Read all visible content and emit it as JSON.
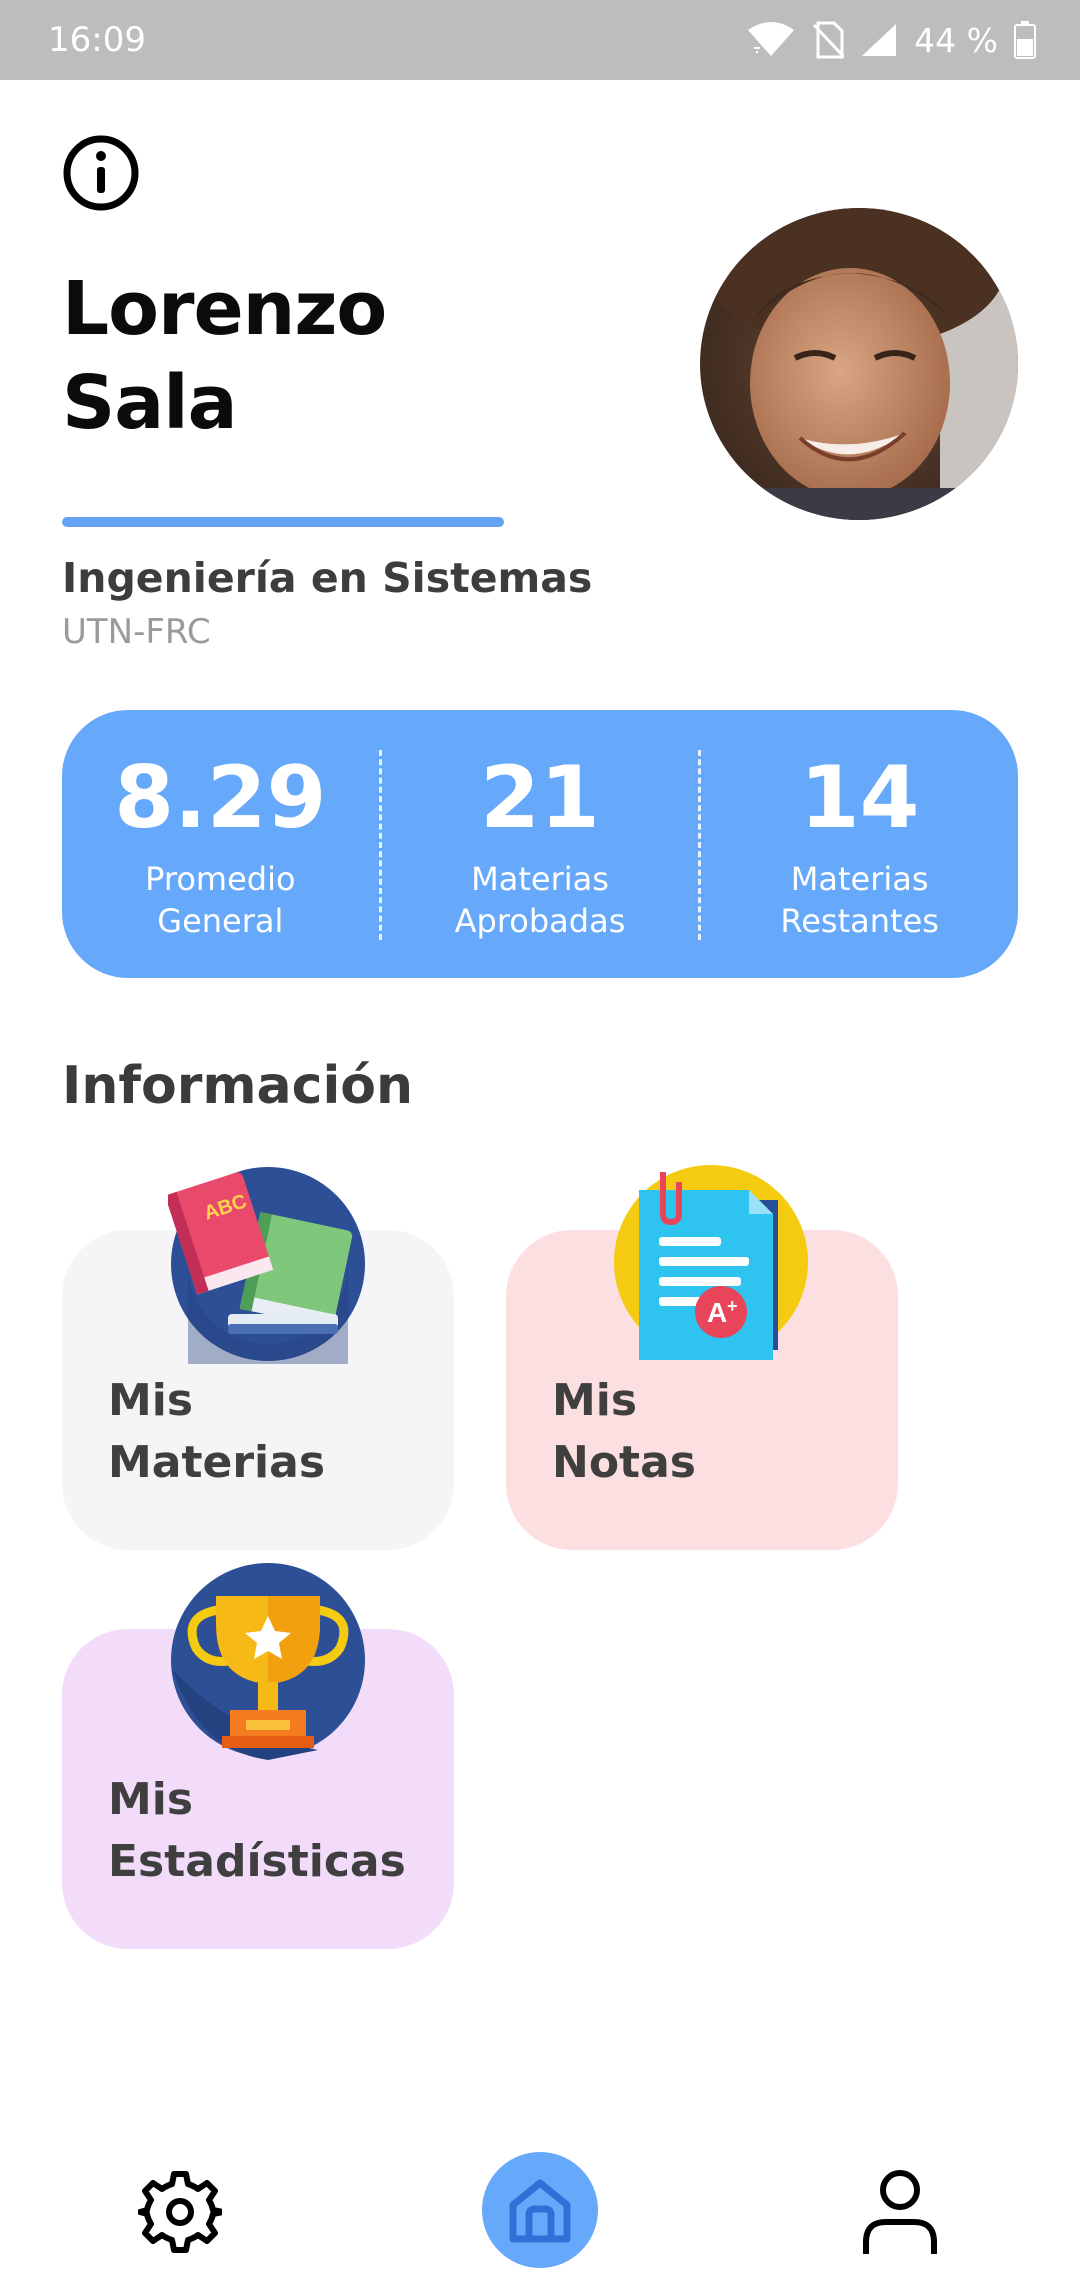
{
  "status_bar": {
    "time": "16:09",
    "battery_percent": "44 %"
  },
  "profile": {
    "first_name": "Lorenzo",
    "last_name": "Sala",
    "career": "Ingeniería en Sistemas",
    "university": "UTN-FRC"
  },
  "stats": [
    {
      "value": "8.29",
      "label_line1": "Promedio",
      "label_line2": "General"
    },
    {
      "value": "21",
      "label_line1": "Materias",
      "label_line2": "Aprobadas"
    },
    {
      "value": "14",
      "label_line1": "Materias",
      "label_line2": "Restantes"
    }
  ],
  "section_title": "Información",
  "cards": [
    {
      "line1": "Mis",
      "line2": "Materias",
      "icon": "books-icon"
    },
    {
      "line1": "Mis",
      "line2": "Notas",
      "icon": "graded-document-icon"
    },
    {
      "line1": "Mis",
      "line2": "Estadísticas",
      "icon": "trophy-icon"
    }
  ],
  "nav": {
    "left_icon": "gear-icon",
    "center_icon": "home-icon",
    "right_icon": "user-icon",
    "active": "home"
  },
  "colors": {
    "accent": "#66a8fa",
    "card_materias": "#f5f5f7",
    "card_notas": "#fcdfe0",
    "card_estadisticas": "#f2dcfa",
    "status_bar": "#bdbdbd"
  }
}
